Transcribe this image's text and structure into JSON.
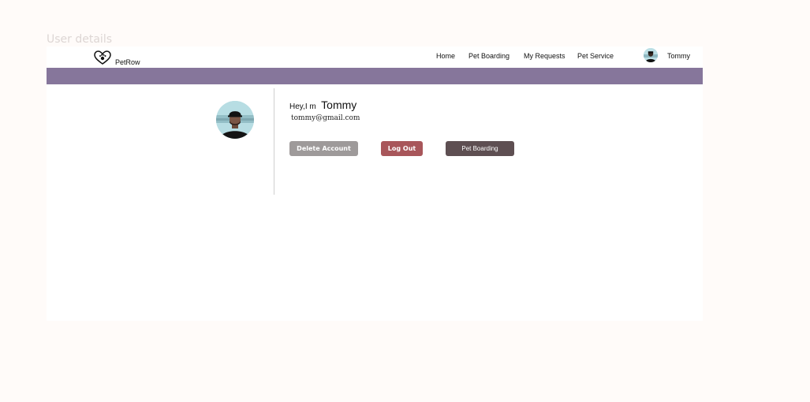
{
  "page": {
    "frame_label": "User details"
  },
  "navbar": {
    "brand": "PetRow",
    "logo_icon": "paw-heart-icon",
    "links": [
      {
        "label": "Home"
      },
      {
        "label": "Pet Boarding"
      },
      {
        "label": "My Requests"
      },
      {
        "label": "Pet Service"
      }
    ],
    "user": {
      "name": "Tommy",
      "avatar_icon": "user-avatar"
    }
  },
  "colors": {
    "banner": "#86769b",
    "delete_button": "#9e9a9a",
    "logout_button": "#a8565a",
    "boarding_button": "#5e4f52"
  },
  "profile": {
    "greeting_prefix": "Hey,I m",
    "name": "Tommy",
    "email": "tommy@gmail.com"
  },
  "actions": {
    "delete_label": "Delete Account",
    "logout_label": "Log Out",
    "boarding_label": "Pet Boarding"
  }
}
